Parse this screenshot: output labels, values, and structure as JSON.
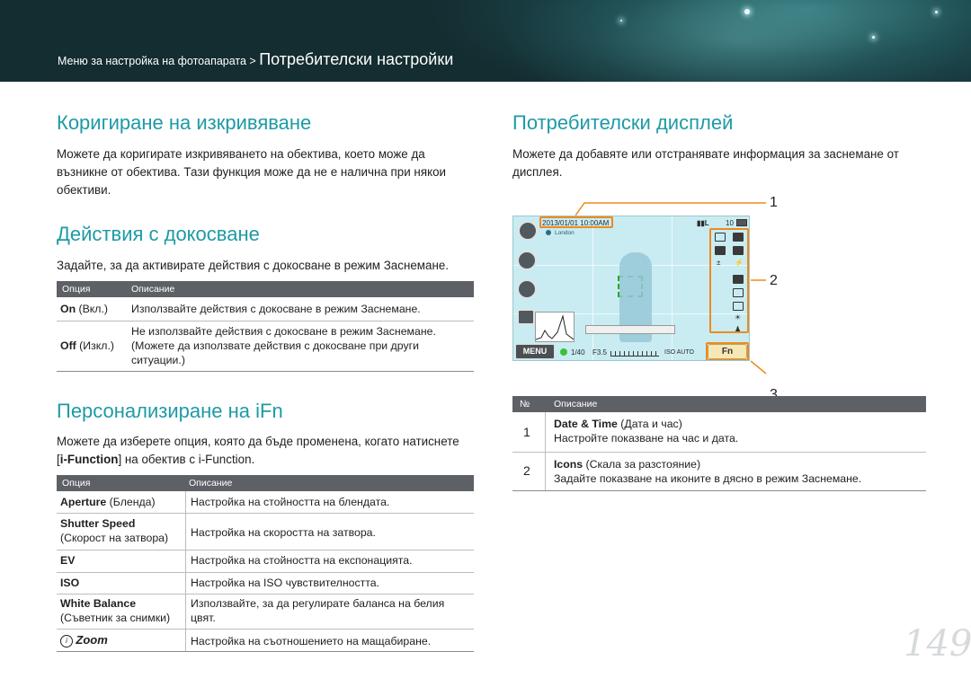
{
  "header": {
    "breadcrumb_small": "Меню за настройка на фотоапарата > ",
    "breadcrumb_large": "Потребителски настройки"
  },
  "left": {
    "s1_title": "Коригиране на изкривяване",
    "s1_text": [
      "Можете да коригирате изкривяването на обектива, което може да",
      "възникне от обектива. Тази функция може да не е налична при някои",
      "обективи."
    ],
    "s2_title": "Действия с докосване",
    "s2_text": "Задайте, за да активирате действия с докосване в режим Заснемане.",
    "t1_head": [
      "Опция",
      "Описание"
    ],
    "t1_rows": [
      {
        "opt_b": "On",
        "opt_n": " (Вкл.)",
        "desc": [
          "Използвайте действия с докосване в режим Заснемане."
        ]
      },
      {
        "opt_b": "Off",
        "opt_n": " (Изкл.)",
        "desc": [
          "Не използвайте действия с докосване в режим Заснемане.",
          "(Можете да използвате действия с докосване при други",
          "ситуации.)"
        ]
      }
    ],
    "s3_title": "Персонализиране на iFn",
    "s3_text_1": "Можете да изберете опция, която да бъде променена, когато натиснете",
    "s3_text_2a": "[",
    "s3_text_2b": "i-Function",
    "s3_text_2c": "] на обектив с i-Function.",
    "t2_head": [
      "Опция",
      "Описание"
    ],
    "t2_rows": [
      {
        "opt_b": "Aperture",
        "opt_n": " (Бленда)",
        "opt2": "",
        "desc": [
          "Настройка на стойността на блендата."
        ]
      },
      {
        "opt_b": "Shutter Speed",
        "opt_n": "",
        "opt2": "(Скорост на затвора)",
        "desc": [
          "Настройка на скоростта на затвора."
        ]
      },
      {
        "opt_b": "EV",
        "opt_n": "",
        "opt2": "",
        "desc": [
          "Настройка на стойността на експонацията."
        ]
      },
      {
        "opt_b": "ISO",
        "opt_n": "",
        "opt2": "",
        "desc": [
          "Настройка на ISO чувствителността."
        ]
      },
      {
        "opt_b": "White Balance",
        "opt_n": "",
        "opt2": "(Съветник за снимки)",
        "desc": [
          "Използвайте, за да регулирате баланса на белия",
          "цвят."
        ]
      },
      {
        "opt_b": "Zoom",
        "opt_n": "",
        "opt2": "",
        "desc": [
          "Настройка на съотношението на мащабиране."
        ]
      }
    ]
  },
  "right": {
    "s4_title": "Потребителски дисплей",
    "s4_text": [
      "Можете да добавяте или отстранявате информация за заснемане от",
      "дисплея."
    ],
    "callouts": [
      "1",
      "2",
      "3"
    ],
    "cam": {
      "date": "2013/01/01 10:00AM",
      "location": "London",
      "shots": "10",
      "menu": "MENU",
      "fn": "Fn",
      "shutter": "1/40",
      "aperture": "F3.5",
      "iso": "ISO AUTO"
    },
    "t3_head": [
      "№",
      "Описание"
    ],
    "t3_rows": [
      {
        "num": "1",
        "title_b": "Date & Time",
        "title_n": " (Дата и час)",
        "desc": "Настройте показване на час и дата."
      },
      {
        "num": "2",
        "title_b": "Icons",
        "title_n": " (Скала за разстояние)",
        "desc": "Задайте показване на иконите в дясно в режим Заснемане."
      }
    ]
  },
  "page_number": "149",
  "colors": {
    "accent": "#1e9aa6",
    "table_header": "#5d6166",
    "highlight": "#f08a1c"
  }
}
